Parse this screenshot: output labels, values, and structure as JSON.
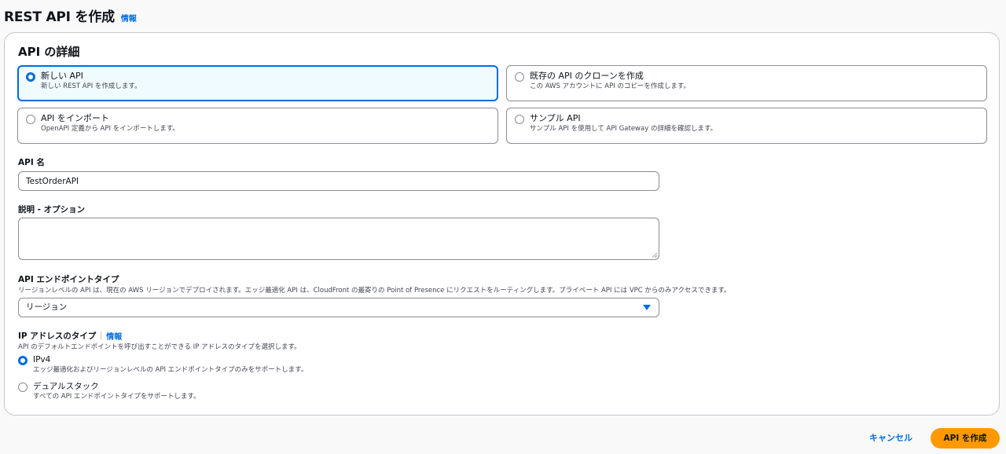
{
  "header": {
    "title": "REST API を作成",
    "info": "情報"
  },
  "details": {
    "title": "API の詳細",
    "options": [
      {
        "title": "新しい API",
        "desc": "新しい REST API を作成します。"
      },
      {
        "title": "既存の API のクローンを作成",
        "desc": "この AWS アカウントに API のコピーを作成します。"
      },
      {
        "title": "API をインポート",
        "desc": "OpenAPI 定義から API をインポートします。"
      },
      {
        "title": "サンプル API",
        "desc": "サンプル API を使用して API Gateway の詳細を確認します。"
      }
    ],
    "selected_option": "新しい API"
  },
  "api_name": {
    "label": "API 名",
    "value": "TestOrderAPI"
  },
  "description": {
    "label": "説明 - オプション",
    "value": ""
  },
  "endpoint": {
    "label": "API エンドポイントタイプ",
    "desc": "リージョンレベルの API は、現在の AWS リージョンでデプロイされます。エッジ最適化 API は、CloudFront の最寄りの Point of Presence にリクエストをルーティングします。プライベート API には VPC からのみアクセスできます。",
    "selected": "リージョン"
  },
  "ip_type": {
    "label": "IP アドレスのタイプ",
    "info": "情報",
    "desc": "API のデフォルトエンドポイントを呼び出すことができる IP アドレスのタイプを選択します。",
    "options": [
      {
        "title": "IPv4",
        "desc": "エッジ最適化およびリージョンレベルの API エンドポイントタイプのみをサポートします。"
      },
      {
        "title": "デュアルスタック",
        "desc": "すべての API エンドポイントタイプをサポートします。"
      }
    ],
    "selected": "IPv4"
  },
  "footer": {
    "cancel": "キャンセル",
    "create": "API を作成"
  },
  "colors": {
    "accent": "#006ce0",
    "primary_button": "#ff9900",
    "selected_tile_bg": "#f0fbff"
  }
}
